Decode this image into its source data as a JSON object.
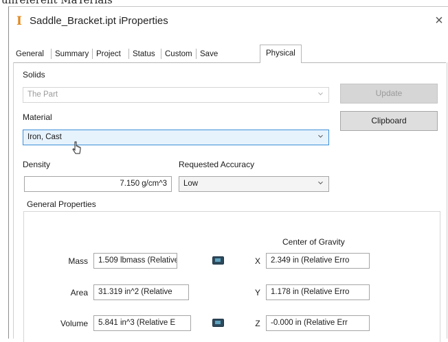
{
  "top_fragment": "unreferent MaTerials",
  "window": {
    "title": "Saddle_Bracket.ipt iProperties",
    "close_glyph": "×"
  },
  "tabs": [
    {
      "label": "General"
    },
    {
      "label": "Summary"
    },
    {
      "label": "Project"
    },
    {
      "label": "Status"
    },
    {
      "label": "Custom"
    },
    {
      "label": "Save"
    },
    {
      "label": "Physical",
      "active": true
    }
  ],
  "physical": {
    "solids_label": "Solids",
    "solids_value": "The Part",
    "material_label": "Material",
    "material_value": "Iron, Cast",
    "density_label": "Density",
    "density_value": "7.150 g/cm^3",
    "accuracy_label": "Requested Accuracy",
    "accuracy_value": "Low",
    "update_button": "Update",
    "clipboard_button": "Clipboard",
    "general_properties_title": "General Properties",
    "center_of_gravity_label": "Center of Gravity",
    "mass_label": "Mass",
    "mass_value": "1.509 lbmass (Relative",
    "area_label": "Area",
    "area_value": "31.319 in^2 (Relative",
    "volume_label": "Volume",
    "volume_value": "5.841 in^3 (Relative E",
    "x_label": "X",
    "x_value": "2.349 in (Relative Erro",
    "y_label": "Y",
    "y_value": "1.178 in (Relative Erro",
    "z_label": "Z",
    "z_value": "-0.000 in (Relative Err"
  },
  "icons": {
    "app": "inventor-part-icon",
    "dropdown": "chevron-down-icon",
    "copy": "copy-to-clipboard-icon",
    "cursor": "mouse-cursor-icon"
  },
  "colors": {
    "app_icon": "#e0871c",
    "focused_field_bg": "#e6f2fc",
    "focused_field_border": "#3c8ed6",
    "copy_icon": "#2d4a5c"
  }
}
